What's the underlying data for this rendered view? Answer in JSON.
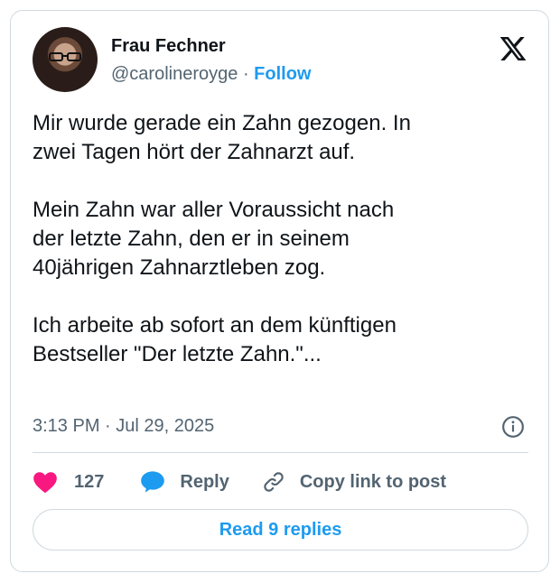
{
  "author": {
    "name": "Frau Fechner",
    "handle": "@carolineroyge",
    "separator": "·",
    "follow_label": "Follow"
  },
  "tweet": {
    "text": "Mir wurde gerade ein Zahn gezogen. In\nzwei Tagen hört der Zahnarzt auf.\n\nMein Zahn war aller Voraussicht nach\nder letzte Zahn, den er in seinem\n40jährigen Zahnarztleben zog.\n\nIch arbeite ab sofort an dem künftigen\nBestseller \"Der letzte Zahn.\"...",
    "timestamp": "3:13 PM · Jul 29, 2025"
  },
  "actions": {
    "like_count": "127",
    "reply_label": "Reply",
    "copy_label": "Copy link to post"
  },
  "read_replies_label": "Read 9 replies",
  "icons": {
    "x_logo": "x-logo-icon",
    "info": "info-icon",
    "heart": "heart-icon",
    "reply": "speech-bubble-icon",
    "link": "link-icon"
  },
  "colors": {
    "accent": "#1d9bf0",
    "like": "#f91880",
    "muted": "#536471",
    "border": "#cfd9de"
  }
}
